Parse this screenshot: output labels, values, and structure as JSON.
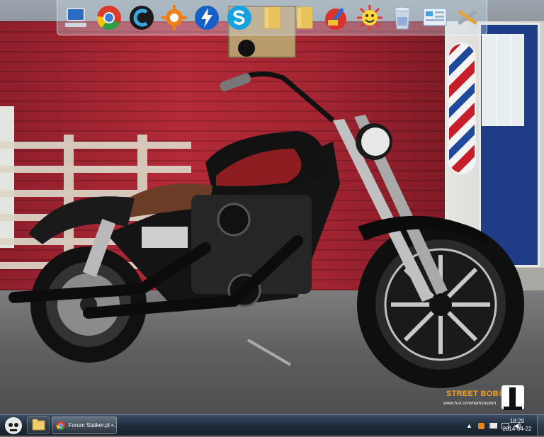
{
  "dock": {
    "items": [
      {
        "name": "my-computer-icon"
      },
      {
        "name": "chrome-icon"
      },
      {
        "name": "ccleaner-icon"
      },
      {
        "name": "avast-icon"
      },
      {
        "name": "speed-booster-icon"
      },
      {
        "name": "skype-icon"
      },
      {
        "name": "folder-icon"
      },
      {
        "name": "folder-icon-2"
      },
      {
        "name": "cleaner-brush-icon"
      },
      {
        "name": "smiley-icon"
      },
      {
        "name": "recycle-bin-icon"
      },
      {
        "name": "control-panel-icon"
      },
      {
        "name": "tools-icon"
      }
    ]
  },
  "wallpaper": {
    "brand_title": "STREET BOB®",
    "brand_url": "www.h-d.com/darkcustom"
  },
  "taskbar": {
    "chrome_task_label": "Forum Stalker.pl •...",
    "clock_time": "18:29",
    "clock_date": "2014-04-22"
  },
  "colors": {
    "taskbar_bg": "#1f2c3b",
    "brand_orange": "#f0a22a",
    "brick_red": "#b42a38"
  }
}
